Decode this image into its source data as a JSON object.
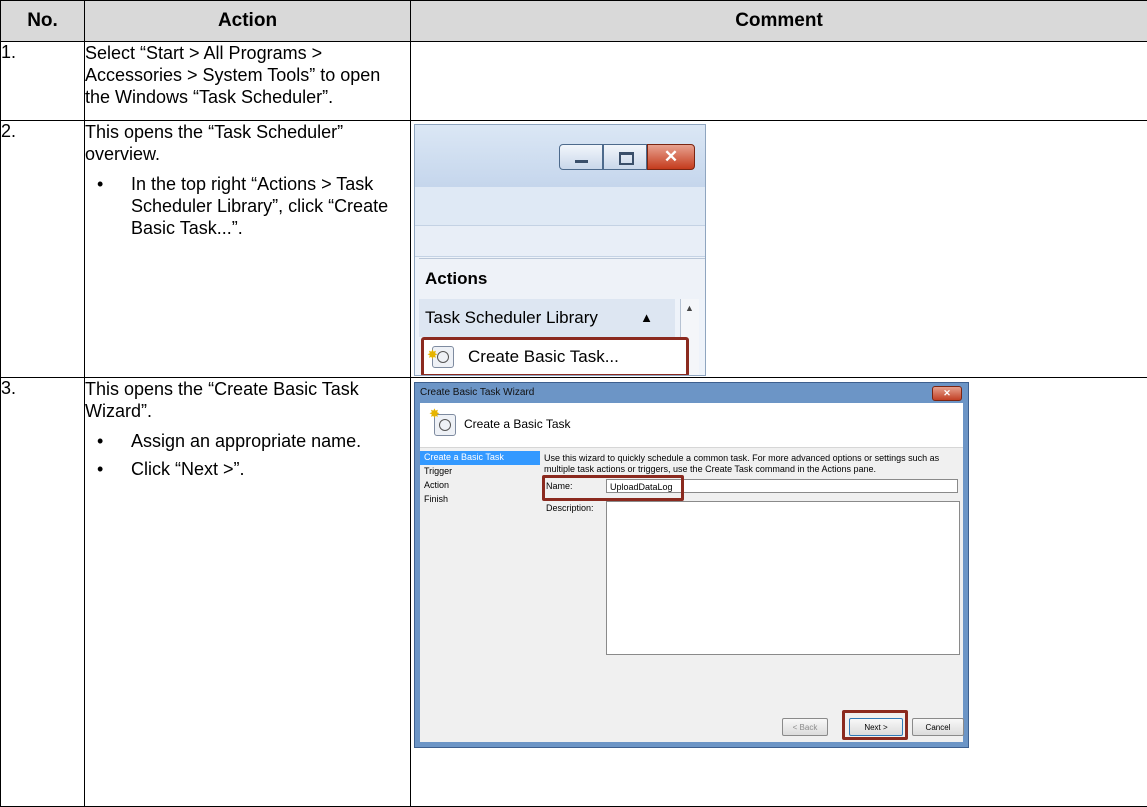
{
  "table": {
    "headers": {
      "no": "No.",
      "action": "Action",
      "comment": "Comment"
    }
  },
  "steps": [
    {
      "no": "1.",
      "action_text": "Select “Start > All Programs > Accessories > System Tools” to open the Windows “Task Scheduler”."
    },
    {
      "no": "2.",
      "action_text": "This opens the “Task Scheduler” overview.",
      "bullets": [
        "In the top right “Actions > Task Scheduler Library”, click “Create Basic Task...”."
      ],
      "screenshot": {
        "actions_title": "Actions",
        "library_label": "Task Scheduler Library",
        "create_label": "Create Basic Task...",
        "close_glyph": "✕"
      }
    },
    {
      "no": "3.",
      "action_text": "This opens the “Create Basic Task Wizard”.",
      "bullets": [
        "Assign an appropriate name.",
        "Click “Next >”."
      ],
      "screenshot": {
        "window_title": "Create Basic Task Wizard",
        "close_glyph": "✕",
        "header_title": "Create a Basic Task",
        "steps": [
          "Create a Basic Task",
          "Trigger",
          "Action",
          "Finish"
        ],
        "intro": "Use this wizard to quickly schedule a common task.  For more advanced options or settings such as multiple task actions or triggers, use the Create Task command in the Actions pane.",
        "name_label": "Name:",
        "name_value": "UploadDataLog",
        "description_label": "Description:",
        "back_label": "< Back",
        "next_label": "Next >",
        "cancel_label": "Cancel"
      }
    }
  ]
}
